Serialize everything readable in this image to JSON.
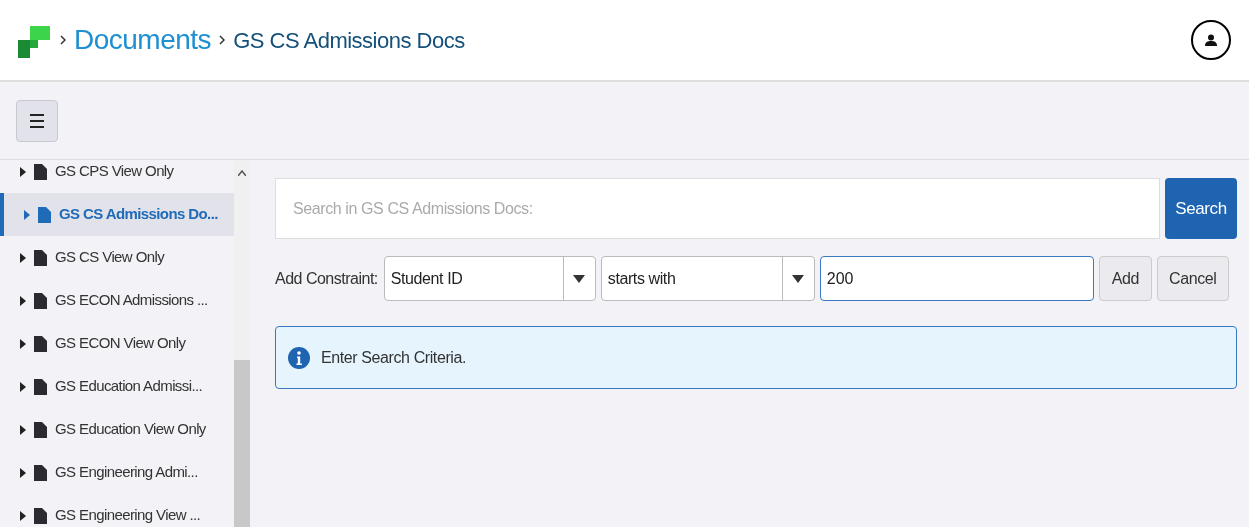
{
  "breadcrumb": [
    {
      "label": "Documents",
      "kind": "link"
    },
    {
      "label": "GS CS Admissions Docs",
      "kind": "current"
    }
  ],
  "sidebar": {
    "items": [
      {
        "label": "GS CPS View Only",
        "selected": false
      },
      {
        "label": "GS CS Admissions Do...",
        "selected": true
      },
      {
        "label": "GS CS View Only",
        "selected": false
      },
      {
        "label": "GS ECON Admissions ...",
        "selected": false
      },
      {
        "label": "GS ECON View Only",
        "selected": false
      },
      {
        "label": "GS Education Admissi...",
        "selected": false
      },
      {
        "label": "GS Education View Only",
        "selected": false
      },
      {
        "label": "GS Engineering Admi...",
        "selected": false
      },
      {
        "label": "GS Engineering View ...",
        "selected": false
      }
    ]
  },
  "search": {
    "placeholder": "Search in GS CS Admissions Docs:",
    "button": "Search"
  },
  "constraint": {
    "label": "Add Constraint:",
    "field": "Student ID",
    "operator": "starts with",
    "value": "200",
    "add": "Add",
    "cancel": "Cancel"
  },
  "info": "Enter Search Criteria."
}
